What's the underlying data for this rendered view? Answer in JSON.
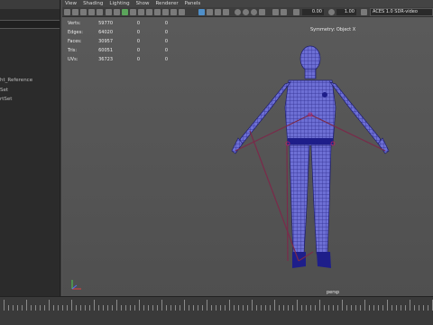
{
  "outliner": {
    "items": [
      "ht_Reference",
      "Set",
      "rtSet"
    ]
  },
  "menu": [
    "View",
    "Shading",
    "Lighting",
    "Show",
    "Renderer",
    "Panels"
  ],
  "toolbar": {
    "field_a": "0.00",
    "field_b": "1.00",
    "color_space": "ACES 1.0 SDR-video"
  },
  "hud": {
    "rows": [
      {
        "label": "Verts:",
        "a": "59770",
        "b": "0",
        "c": "0"
      },
      {
        "label": "Edges:",
        "a": "64020",
        "b": "0",
        "c": "0"
      },
      {
        "label": "Faces:",
        "a": "30957",
        "b": "0",
        "c": "0"
      },
      {
        "label": "Tris:",
        "a": "60051",
        "b": "0",
        "c": "0"
      },
      {
        "label": "UVs:",
        "a": "36723",
        "b": "0",
        "c": "0"
      }
    ],
    "symmetry": "Symmetry: Object X",
    "camera": "persp"
  },
  "colors": {
    "viewport_bg": "#555555",
    "mesh_wire": "#2e2e8f",
    "mesh_fill": "#6d6fd4",
    "skeleton": "#7a2a4a",
    "accent": "#4f8fc9"
  }
}
